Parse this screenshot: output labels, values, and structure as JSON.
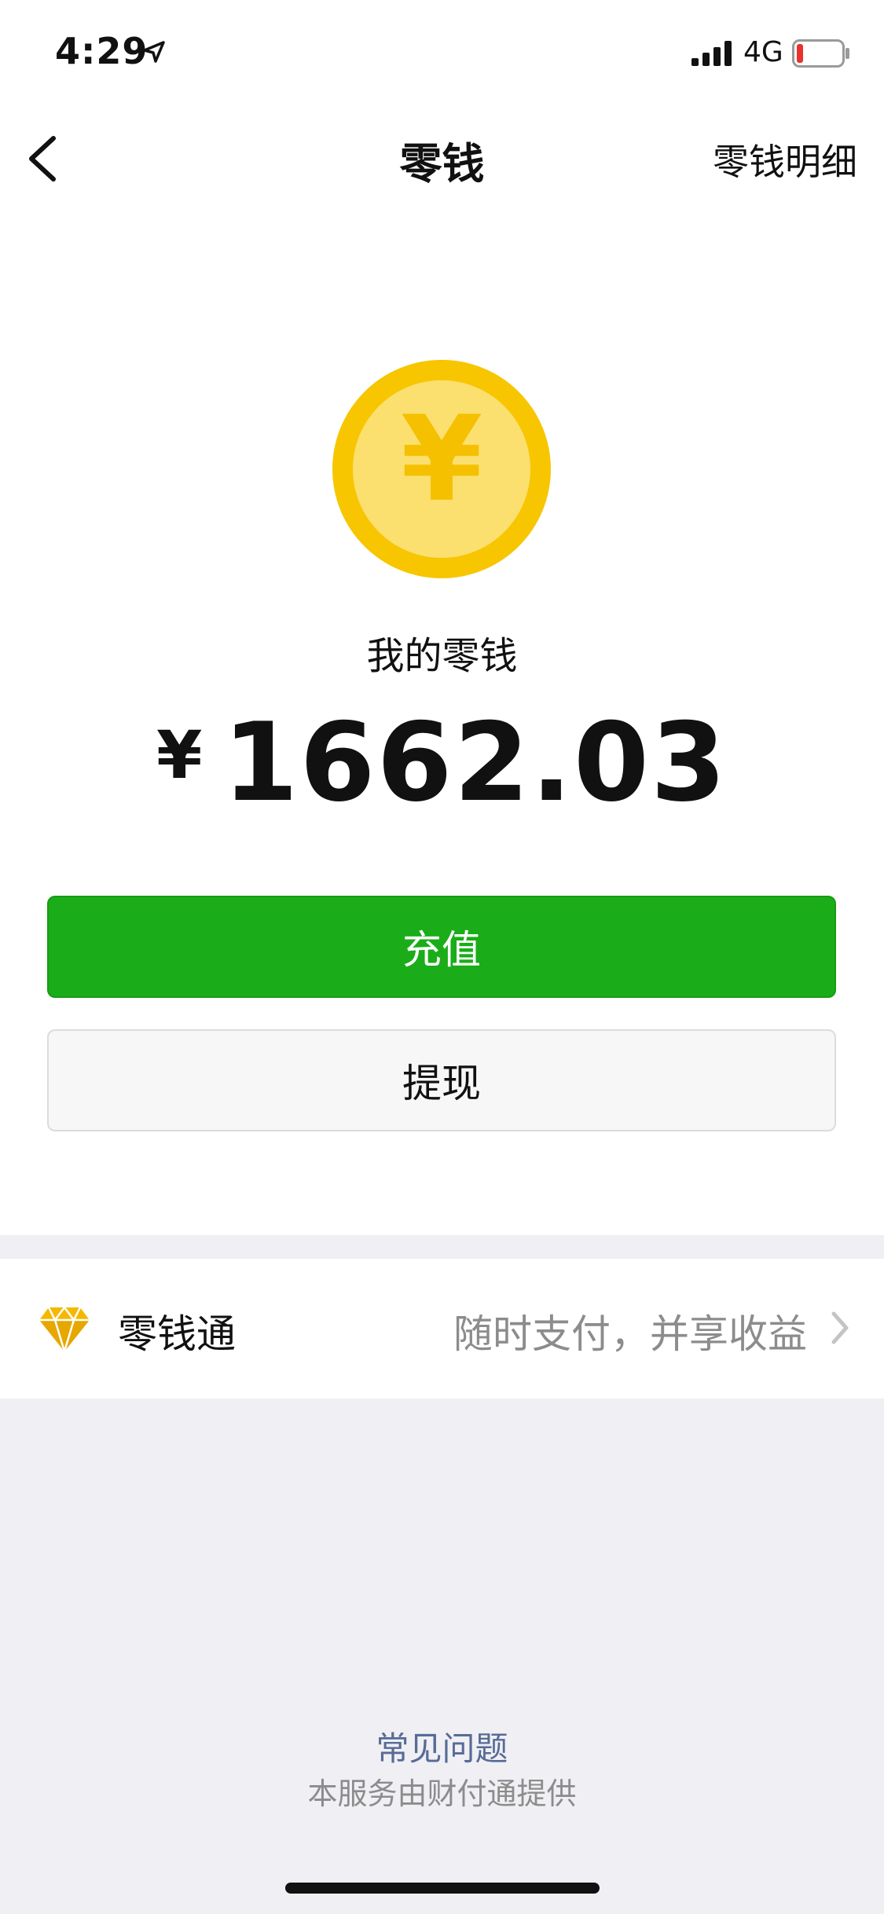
{
  "status": {
    "time": "4:29",
    "network": "4G"
  },
  "nav": {
    "title": "零钱",
    "detail_link": "零钱明细"
  },
  "coin": {
    "symbol": "¥"
  },
  "balance": {
    "label": "我的零钱",
    "currency": "¥",
    "amount": "1662.03"
  },
  "buttons": {
    "recharge": "充值",
    "withdraw": "提现"
  },
  "lingqiantong": {
    "label": "零钱通",
    "desc": "随时支付，并享收益"
  },
  "footer": {
    "faq": "常见问题",
    "provider": "本服务由财付通提供"
  },
  "colors": {
    "primary_green": "#1aad19",
    "coin_outer": "#f7c600",
    "coin_inner": "#fbe06f",
    "link_blue": "#576b95"
  }
}
